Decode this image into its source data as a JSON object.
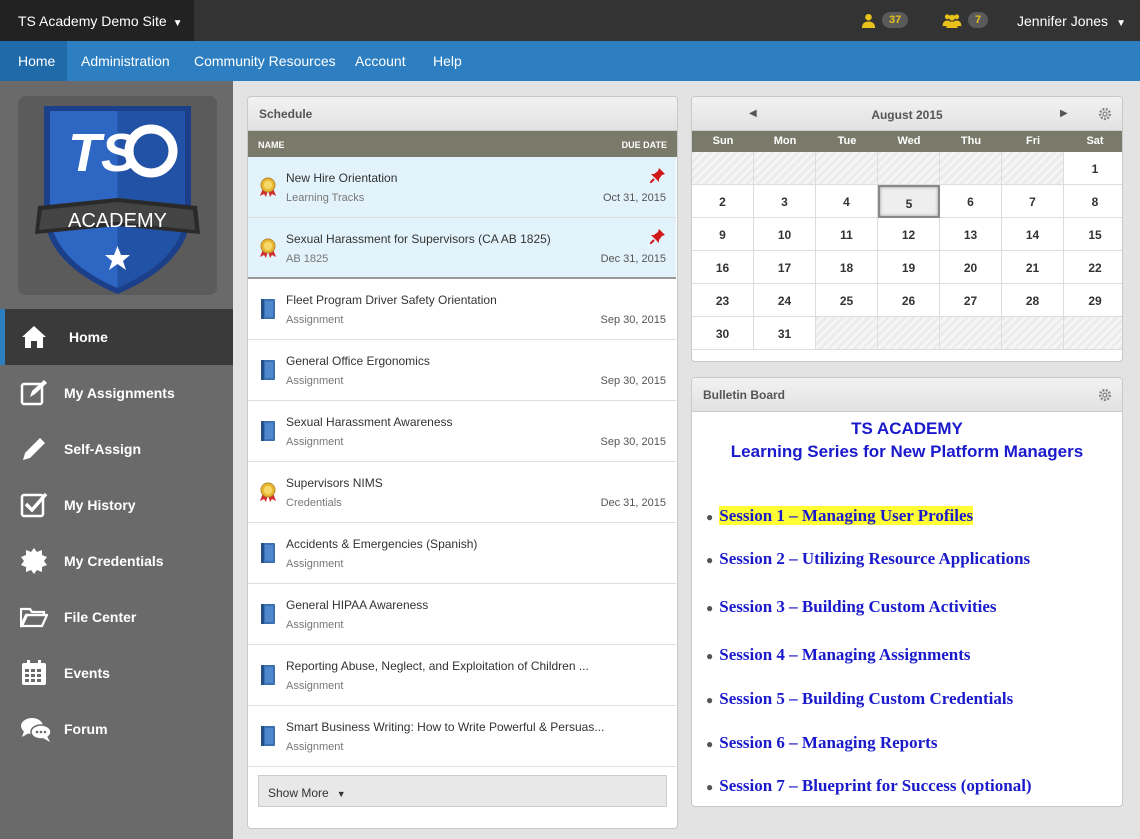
{
  "topbar": {
    "site_name": "TS Academy Demo Site",
    "badge_user_count": "37",
    "badge_group_count": "7",
    "user_name": "Jennifer Jones"
  },
  "nav": [
    {
      "label": "Home"
    },
    {
      "label": "Administration"
    },
    {
      "label": "Community Resources"
    },
    {
      "label": "Account"
    },
    {
      "label": "Help"
    }
  ],
  "logo": {
    "text_top": "TS",
    "text_band": "ACADEMY"
  },
  "sidebar": [
    {
      "label": "Home",
      "icon": "home-icon"
    },
    {
      "label": "My Assignments",
      "icon": "edit-icon"
    },
    {
      "label": "Self-Assign",
      "icon": "pencil-icon"
    },
    {
      "label": "My History",
      "icon": "checkbox-icon"
    },
    {
      "label": "My Credentials",
      "icon": "badge-icon"
    },
    {
      "label": "File Center",
      "icon": "folder-icon"
    },
    {
      "label": "Events",
      "icon": "calendar-icon"
    },
    {
      "label": "Forum",
      "icon": "chat-icon"
    }
  ],
  "schedule": {
    "title": "Schedule",
    "col_name": "NAME",
    "col_due": "DUE DATE",
    "show_more": "Show More",
    "rows": [
      {
        "title": "New Hire Orientation",
        "sub": "Learning Tracks",
        "date": "Oct 31, 2015",
        "icon": "award-icon",
        "pinned": true
      },
      {
        "title": "Sexual Harassment for Supervisors (CA AB 1825)",
        "sub": "AB 1825",
        "date": "Dec 31, 2015",
        "icon": "award-icon",
        "pinned": true
      },
      {
        "title": "Fleet Program Driver Safety Orientation",
        "sub": "Assignment",
        "date": "Sep 30, 2015",
        "icon": "book-icon",
        "pinned": false
      },
      {
        "title": "General Office Ergonomics",
        "sub": "Assignment",
        "date": "Sep 30, 2015",
        "icon": "book-icon",
        "pinned": false
      },
      {
        "title": "Sexual Harassment Awareness",
        "sub": "Assignment",
        "date": "Sep 30, 2015",
        "icon": "book-icon",
        "pinned": false
      },
      {
        "title": "Supervisors NIMS",
        "sub": "Credentials",
        "date": "Dec 31, 2015",
        "icon": "award-icon",
        "pinned": false
      },
      {
        "title": "Accidents & Emergencies (Spanish)",
        "sub": "Assignment",
        "date": "",
        "icon": "book-icon",
        "pinned": false
      },
      {
        "title": "General HIPAA Awareness",
        "sub": "Assignment",
        "date": "",
        "icon": "book-icon",
        "pinned": false
      },
      {
        "title": "Reporting Abuse, Neglect, and Exploitation of Children ...",
        "sub": "Assignment",
        "date": "",
        "icon": "book-icon",
        "pinned": false
      },
      {
        "title": "Smart Business Writing: How to Write Powerful & Persuas...",
        "sub": "Assignment",
        "date": "",
        "icon": "book-icon",
        "pinned": false
      }
    ]
  },
  "calendar": {
    "title": "August 2015",
    "days_of_week": [
      "Sun",
      "Mon",
      "Tue",
      "Wed",
      "Thu",
      "Fri",
      "Sat"
    ],
    "first_weekday": 6,
    "days_in_month": 31,
    "today": 5
  },
  "bulletin": {
    "title": "Bulletin Board",
    "heading1": "TS ACADEMY",
    "heading2": "Learning Series for New Platform Managers",
    "sessions": [
      "Session 1 – Managing User Profiles",
      "Session 2 – Utilizing Resource Applications",
      "Session 3 – Building Custom Activities",
      "Session 4 – Managing Assignments",
      "Session 5 – Building Custom Credentials",
      "Session 6 – Managing Reports",
      "Session 7 – Blueprint for Success (optional)"
    ],
    "highlight_index": 0,
    "highlight_color": "#ffff33"
  },
  "colors": {
    "accent": "#2d7fc1",
    "badge_text": "#e8c21a",
    "link_blue": "#1a1acc"
  }
}
